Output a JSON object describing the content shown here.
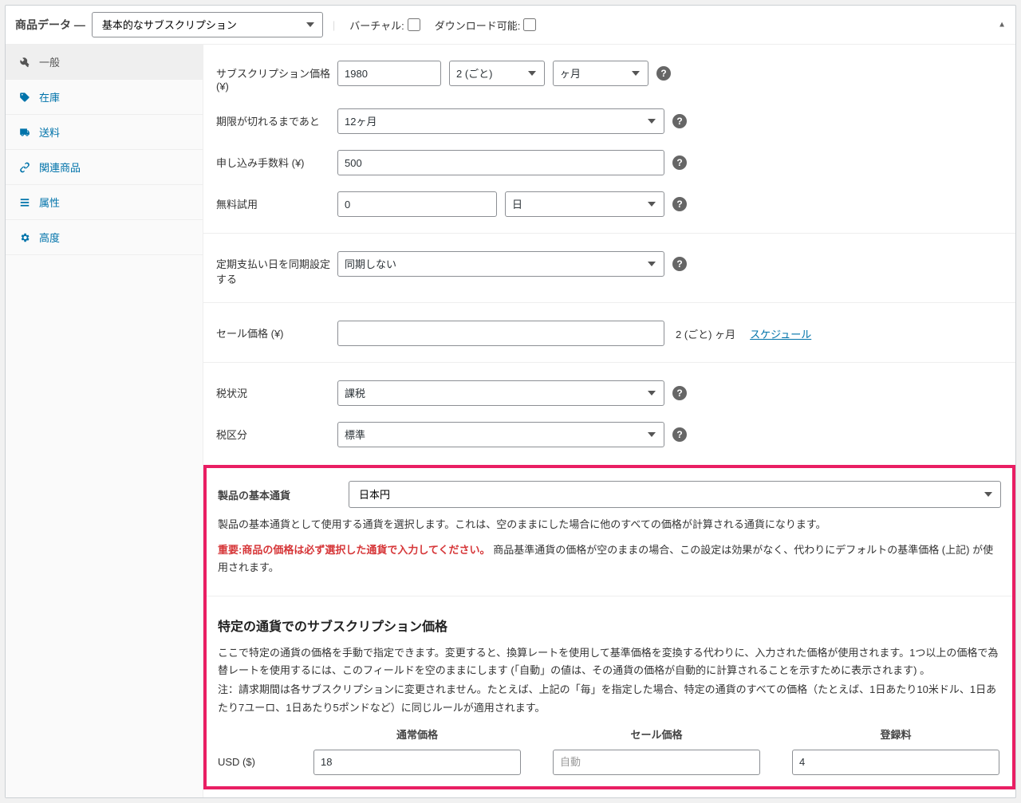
{
  "header": {
    "title": "商品データ —",
    "product_type": "基本的なサブスクリプション",
    "virtual_label": "バーチャル:",
    "downloadable_label": "ダウンロード可能:"
  },
  "tabs": [
    {
      "id": "general",
      "label": "一般",
      "icon": "wrench",
      "active": true
    },
    {
      "id": "inventory",
      "label": "在庫",
      "icon": "tag"
    },
    {
      "id": "shipping",
      "label": "送料",
      "icon": "truck"
    },
    {
      "id": "linked",
      "label": "関連商品",
      "icon": "link"
    },
    {
      "id": "attributes",
      "label": "属性",
      "icon": "list"
    },
    {
      "id": "advanced",
      "label": "高度",
      "icon": "cog"
    }
  ],
  "fields": {
    "subscription_price": {
      "label": "サブスクリプション価格 (¥)",
      "value": "1980",
      "interval": "2 (ごと)",
      "period": "ヶ月"
    },
    "expire": {
      "label": "期限が切れるまであと",
      "value": "12ヶ月"
    },
    "signup_fee": {
      "label": "申し込み手数料 (¥)",
      "value": "500"
    },
    "free_trial": {
      "label": "無料試用",
      "value": "0",
      "period": "日"
    },
    "sync": {
      "label": "定期支払い日を同期設定する",
      "value": "同期しない"
    },
    "sale_price": {
      "label": "セール価格 (¥)",
      "value": "",
      "suffix": "2 (ごと) ヶ月",
      "schedule": "スケジュール"
    },
    "tax_status": {
      "label": "税状況",
      "value": "課税"
    },
    "tax_class": {
      "label": "税区分",
      "value": "標準"
    }
  },
  "base_currency": {
    "label": "製品の基本通貨",
    "value": "日本円",
    "desc1": "製品の基本通貨として使用する通貨を選択します。これは、空のままにした場合に他のすべての価格が計算される通貨になります。",
    "warn": "重要:商品の価格は必ず選択した通貨で入力してください。",
    "desc2": "商品基準通貨の価格が空のままの場合、この設定は効果がなく、代わりにデフォルトの基準価格 (上記) が使用されます。"
  },
  "specific": {
    "title": "特定の通貨でのサブスクリプション価格",
    "desc_a": "ここで特定の通貨の価格を手動で指定できます。変更すると、換算レートを使用して基準価格を変換する代わりに、入力された価格が使用されます。1つ以上の価格で為替レートを使用するには、このフィールドを空のままにします (「自動」の値は、その通貨の価格が自動的に計算されることを示すために表示されます) 。",
    "desc_b": "注：請求期間は各サブスクリプションに変更されません。たとえば、上記の「毎」を指定した場合、特定の通貨のすべての価格（たとえば、1日あたり10米ドル、1日あたり7ユーロ、1日あたり5ポンドなど）に同じルールが適用されます。",
    "headers": {
      "regular": "通常価格",
      "sale": "セール価格",
      "signup": "登録料"
    },
    "rows": [
      {
        "currency": "USD ($)",
        "regular": "18",
        "sale": "",
        "sale_placeholder": "自動",
        "signup": "4"
      }
    ]
  }
}
